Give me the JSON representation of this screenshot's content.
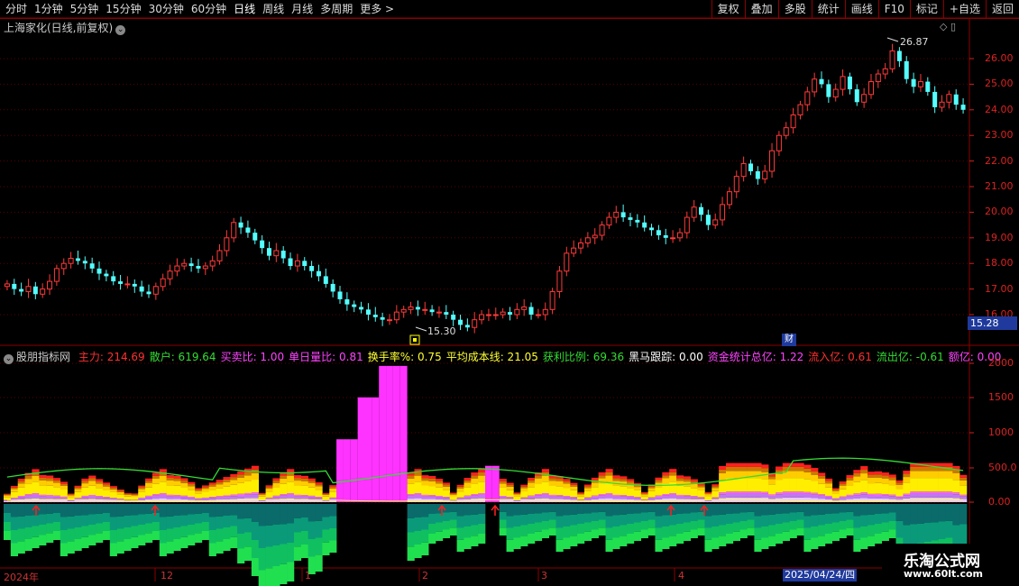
{
  "toolbar": {
    "periods": [
      "分时",
      "1分钟",
      "5分钟",
      "15分钟",
      "30分钟",
      "60分钟",
      "日线",
      "周线",
      "月线",
      "多周期",
      "更多 >"
    ],
    "tools": [
      "复权",
      "叠加",
      "多股",
      "统计",
      "画线",
      "F10",
      "标记",
      "+自选",
      "返回"
    ]
  },
  "stock": {
    "title": "上海家化(日线,前复权)"
  },
  "price_axis": [
    "26.00",
    "25.00",
    "24.00",
    "23.00",
    "22.00",
    "21.00",
    "20.00",
    "19.00",
    "18.00",
    "17.00",
    "16.00"
  ],
  "markers": {
    "high": "26.87",
    "low": "15.30",
    "last_price": "15.28",
    "finance_badge": "财"
  },
  "indicator": {
    "name": "股朋指标网",
    "items": [
      {
        "label": "主力:",
        "value": "214.69",
        "color": "#ff3030"
      },
      {
        "label": "散户:",
        "value": "619.64",
        "color": "#33dd33"
      },
      {
        "label": "买卖比:",
        "value": "1.00",
        "color": "#ff44ff"
      },
      {
        "label": "单日量比:",
        "value": "0.81",
        "color": "#ff44ff"
      },
      {
        "label": "换手率%:",
        "value": "0.75",
        "color": "#ffff33"
      },
      {
        "label": "平均成本线:",
        "value": "21.05",
        "color": "#ffff33"
      },
      {
        "label": "获利比例:",
        "value": "69.36",
        "color": "#33dd33"
      },
      {
        "label": "黑马跟踪:",
        "value": "0.00",
        "color": "#ffffff"
      },
      {
        "label": "资金统计总亿:",
        "value": "1.22",
        "color": "#ff44ff"
      },
      {
        "label": "流入亿:",
        "value": "0.61",
        "color": "#ff3030"
      },
      {
        "label": "流出亿:",
        "value": "-0.61",
        "color": "#33dd33"
      },
      {
        "label": "额亿:",
        "value": "0.00",
        "color": "#ff44ff"
      }
    ]
  },
  "indicator_axis": [
    "2000",
    "1500",
    "1000",
    "500.0",
    "0.00"
  ],
  "time_axis": [
    "2024年",
    "12",
    "1",
    "2",
    "3",
    "4"
  ],
  "cursor_date": "2025/04/24/四",
  "watermark": {
    "name": "乐淘公式网",
    "url": "www.60lt.com"
  },
  "chart_data": {
    "type": "candlestick",
    "y_range": [
      15.3,
      26.87
    ],
    "closes": [
      17.2,
      17.0,
      16.9,
      17.1,
      16.8,
      17.0,
      17.3,
      17.8,
      18.0,
      18.2,
      18.1,
      18.0,
      17.8,
      17.6,
      17.5,
      17.3,
      17.2,
      17.2,
      17.1,
      16.9,
      16.8,
      17.1,
      17.4,
      17.7,
      17.9,
      18.0,
      17.9,
      17.8,
      17.9,
      18.1,
      18.5,
      19.0,
      19.6,
      19.4,
      19.2,
      18.9,
      18.6,
      18.3,
      18.5,
      18.2,
      17.9,
      18.1,
      17.9,
      17.7,
      17.5,
      17.2,
      16.9,
      16.6,
      16.4,
      16.3,
      16.2,
      16.0,
      15.9,
      15.8,
      15.8,
      16.1,
      16.2,
      16.3,
      16.2,
      16.2,
      16.1,
      16.1,
      16.0,
      15.8,
      15.6,
      15.5,
      15.8,
      16.0,
      16.0,
      16.0,
      16.1,
      16.0,
      16.2,
      16.3,
      16.0,
      16.0,
      16.2,
      16.9,
      17.7,
      18.4,
      18.6,
      18.8,
      19.0,
      19.1,
      19.5,
      19.8,
      20.0,
      19.8,
      19.7,
      19.6,
      19.4,
      19.3,
      19.1,
      19.0,
      19.0,
      19.2,
      19.8,
      20.2,
      19.9,
      19.5,
      19.7,
      20.3,
      20.8,
      21.4,
      21.9,
      21.6,
      21.3,
      21.6,
      22.4,
      23.0,
      23.3,
      23.8,
      24.2,
      24.7,
      25.2,
      25.0,
      24.5,
      24.8,
      25.3,
      24.8,
      24.3,
      24.6,
      25.1,
      25.4,
      25.6,
      26.3,
      25.9,
      25.2,
      24.9,
      25.1,
      24.7,
      24.1,
      24.3,
      24.6,
      24.2,
      24.0
    ]
  }
}
